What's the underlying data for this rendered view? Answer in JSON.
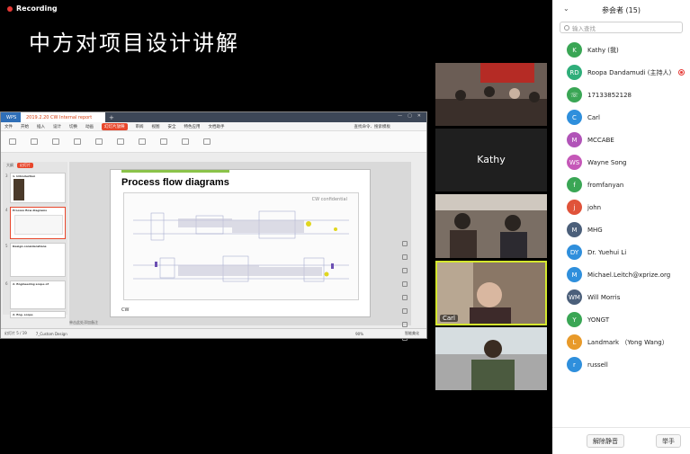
{
  "recording": {
    "label": "Recording",
    "dot_color": "#e53935"
  },
  "slide_caption": "中方对项目设计讲解",
  "shared_screen": {
    "tabs": {
      "wps": "WPS",
      "document": "2019.2.20 CW Internal report"
    },
    "menu": [
      "文件",
      "开始",
      "插入",
      "设计",
      "切换",
      "动画",
      "幻灯片放映",
      "审阅",
      "视图",
      "安全",
      "特色应用",
      "文档助手"
    ],
    "menu_active": "幻灯片放映",
    "search_label": "查找命令、搜索模板",
    "thumb_tabs": [
      "大纲",
      "幻灯片"
    ],
    "thumbnails": [
      {
        "num": "3",
        "title": "1. Introduction"
      },
      {
        "num": "4",
        "title": "Process flow diagrams"
      },
      {
        "num": "5",
        "title": "Design considerations"
      },
      {
        "num": "6",
        "title": "2. Engineering scope of"
      },
      {
        "num": "7",
        "title": "2. Eng. scope"
      }
    ],
    "slide": {
      "heading": "Process flow diagrams",
      "confidential": "CW confidential",
      "logo": "CW"
    },
    "notes_hint": "单击此处添加备注",
    "status": {
      "slide_pos": "幻灯片 5 / 19",
      "theme": "7_Custom Design",
      "zoom": "90%",
      "right": "智能美化"
    }
  },
  "video_tiles": [
    {
      "name": ""
    },
    {
      "name": "Kathy"
    },
    {
      "name": ""
    },
    {
      "name": "Carl"
    },
    {
      "name": ""
    }
  ],
  "participants_panel": {
    "title": "参会者 (15)",
    "search_placeholder": "输入查找",
    "participants": [
      {
        "initials": "K",
        "name": "Kathy (我)",
        "color": "#3aa655"
      },
      {
        "initials": "RD",
        "name": "Roopa Dandamudi (主持人)",
        "color": "#2fae7a",
        "host_icon": true
      },
      {
        "initials": "☏",
        "name": "17133852128",
        "color": "#3aa655"
      },
      {
        "initials": "C",
        "name": "Carl",
        "color": "#2f8fdc"
      },
      {
        "initials": "M",
        "name": "MCCABE",
        "color": "#b154b8"
      },
      {
        "initials": "WS",
        "name": "Wayne Song",
        "color": "#c558b8"
      },
      {
        "initials": "f",
        "name": "fromfanyan",
        "color": "#3aa655"
      },
      {
        "initials": "j",
        "name": "john",
        "color": "#e0533a"
      },
      {
        "initials": "M",
        "name": "MHG",
        "color": "#4b5f7a"
      },
      {
        "initials": "DY",
        "name": "Dr. Yuehui Li",
        "color": "#2f8fdc"
      },
      {
        "initials": "M",
        "name": "Michael.Leitch@xprize.org",
        "color": "#2f8fdc"
      },
      {
        "initials": "WM",
        "name": "Will Morris",
        "color": "#4b5f7a"
      },
      {
        "initials": "Y",
        "name": "YONGT",
        "color": "#3aa655"
      },
      {
        "initials": "L",
        "name": "Landmark （Yong Wang）",
        "color": "#e89a2a"
      },
      {
        "initials": "r",
        "name": "russell",
        "color": "#2f8fdc"
      }
    ],
    "mute_all": "解除静音",
    "raise_hand": "举手"
  }
}
